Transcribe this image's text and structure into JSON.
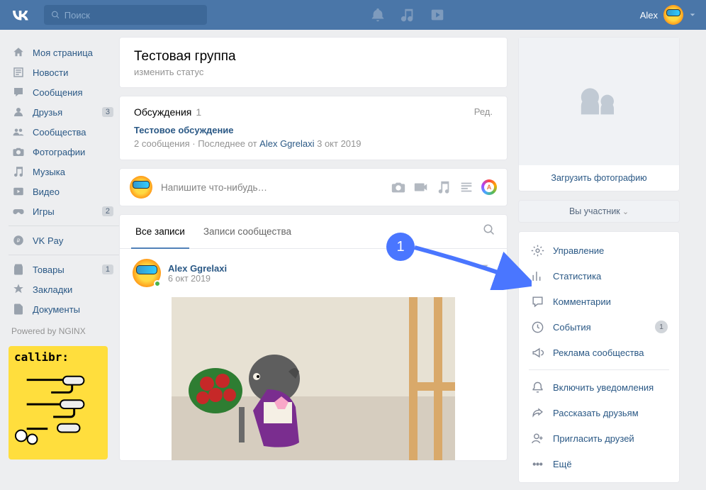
{
  "topbar": {
    "search_placeholder": "Поиск",
    "user_name": "Alex"
  },
  "sidebar": {
    "items": [
      {
        "label": "Моя страница",
        "icon": "home"
      },
      {
        "label": "Новости",
        "icon": "news"
      },
      {
        "label": "Сообщения",
        "icon": "msg"
      },
      {
        "label": "Друзья",
        "icon": "friends",
        "badge": "3"
      },
      {
        "label": "Сообщества",
        "icon": "groups"
      },
      {
        "label": "Фотографии",
        "icon": "photo"
      },
      {
        "label": "Музыка",
        "icon": "music"
      },
      {
        "label": "Видео",
        "icon": "video"
      },
      {
        "label": "Игры",
        "icon": "games",
        "badge": "2"
      }
    ],
    "items2": [
      {
        "label": "VK Pay",
        "icon": "pay"
      }
    ],
    "items3": [
      {
        "label": "Товары",
        "icon": "market",
        "badge": "1"
      },
      {
        "label": "Закладки",
        "icon": "bookmark"
      },
      {
        "label": "Документы",
        "icon": "docs"
      }
    ],
    "powered": "Powered by NGINX",
    "ad_text": "callibr:"
  },
  "group": {
    "title": "Тестовая группа",
    "status": "изменить статус",
    "discussions": {
      "heading": "Обсуждения",
      "count": "1",
      "edit": "Ред.",
      "topic": "Тестовое обсуждение",
      "meta_prefix": "2 сообщения   ·   Последнее от ",
      "meta_author": "Alex Ggrelaxi",
      "meta_date": " 3 окт 2019"
    },
    "composer_placeholder": "Напишите что-нибудь…",
    "tabs": {
      "all": "Все записи",
      "community": "Записи сообщества"
    },
    "post": {
      "author": "Alex Ggrelaxi",
      "date": "6 окт 2019"
    }
  },
  "right": {
    "upload_label": "Загрузить фотографию",
    "member_label": "Вы участник",
    "manage": [
      {
        "label": "Управление",
        "icon": "gear"
      },
      {
        "label": "Статистика",
        "icon": "stats"
      },
      {
        "label": "Комментарии",
        "icon": "comment"
      },
      {
        "label": "События",
        "icon": "event",
        "badge": "1"
      },
      {
        "label": "Реклама сообщества",
        "icon": "ads"
      }
    ],
    "actions": [
      {
        "label": "Включить уведомления",
        "icon": "bell"
      },
      {
        "label": "Рассказать друзьям",
        "icon": "share"
      },
      {
        "label": "Пригласить друзей",
        "icon": "invite"
      },
      {
        "label": "Ещё",
        "icon": "more"
      }
    ]
  },
  "annotation": {
    "number": "1"
  }
}
